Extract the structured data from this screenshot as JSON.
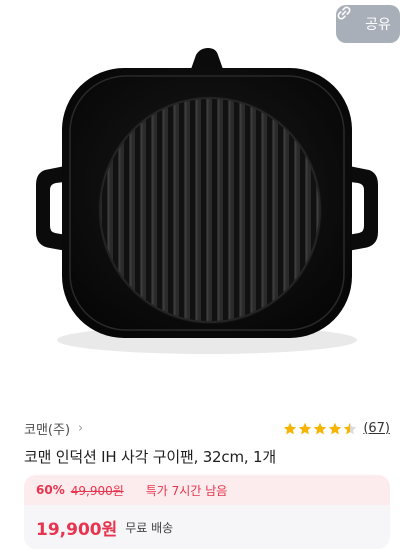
{
  "share": {
    "label": "공유",
    "icon": "link-icon"
  },
  "product": {
    "seller": "코맨(주)",
    "title": "코맨 인덕션 IH 사각 구이팬, 32cm, 1개",
    "rating": 4.5,
    "review_count": "(67)",
    "discount": "60%",
    "original_price": "49,900원",
    "deal_text": "특가 7시간 남음",
    "price": "19,900원",
    "shipping": "무료 배송"
  },
  "colors": {
    "accent": "#e8344e",
    "star": "#f5b400"
  }
}
